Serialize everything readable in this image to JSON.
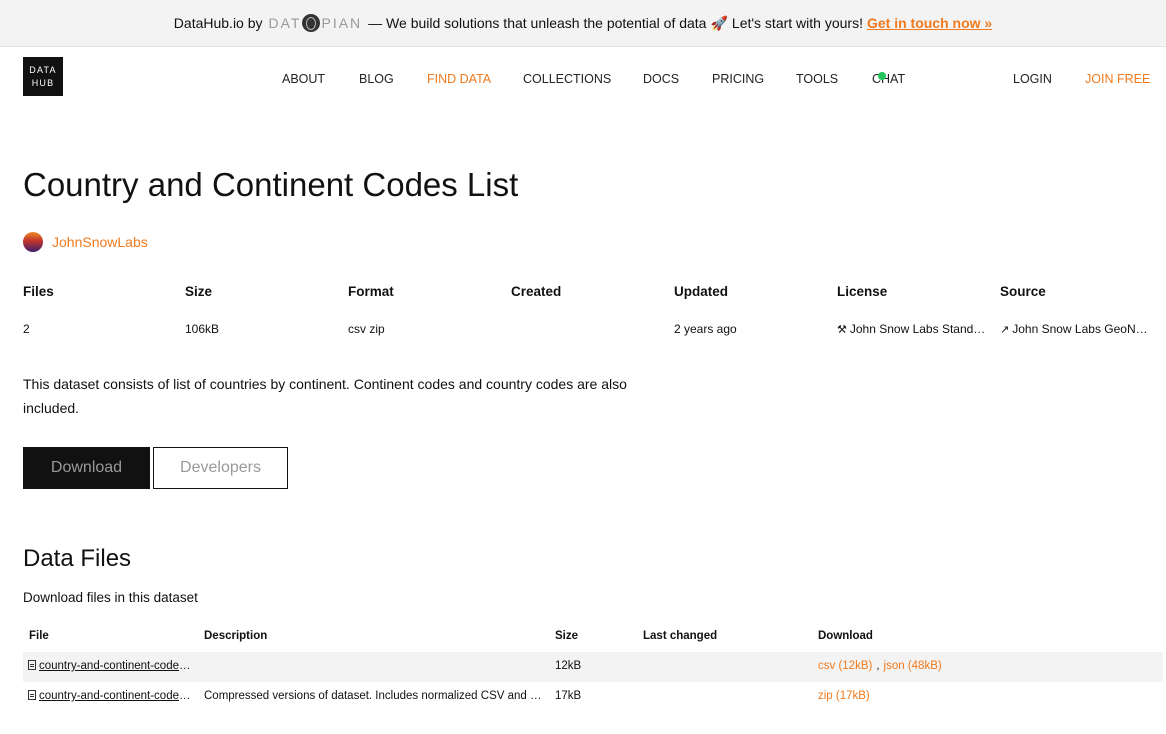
{
  "banner": {
    "prefix": "DataHub.io by",
    "brand": "DAT PIAN",
    "message": "— We build solutions that unleash the potential of data",
    "rocket_icon": "rocket-icon",
    "message2": "Let's start with yours!",
    "cta": "Get in touch now »"
  },
  "logo": {
    "line1": "DATA",
    "line2": "HUB"
  },
  "nav": {
    "items": [
      "ABOUT",
      "BLOG",
      "FIND DATA",
      "COLLECTIONS",
      "DOCS",
      "PRICING",
      "TOOLS",
      "CHAT"
    ],
    "active": "FIND DATA",
    "login": "LOGIN",
    "join": "JOIN FREE"
  },
  "dataset": {
    "title": "Country and Continent Codes List",
    "author": "JohnSnowLabs",
    "meta": {
      "headers": [
        "Files",
        "Size",
        "Format",
        "Created",
        "Updated",
        "License",
        "Source"
      ],
      "files": "2",
      "size": "106kB",
      "format": "csv zip",
      "created": "",
      "updated": "2 years ago",
      "license": "John Snow Labs Standard License",
      "source": "John Snow Labs GeoNames"
    },
    "description": "This dataset consists of list of countries by continent. Continent codes and country codes are also included.",
    "buttons": {
      "download": "Download",
      "developers": "Developers"
    }
  },
  "data_files": {
    "title": "Data Files",
    "subtitle": "Download files in this dataset",
    "headers": [
      "File",
      "Description",
      "Size",
      "Last changed",
      "Download"
    ],
    "rows": [
      {
        "file": "country-and-continent-codes-list-csv",
        "description": "",
        "size": "12kB",
        "last_changed": "",
        "downloads": [
          "csv (12kB)",
          "json (48kB)"
        ]
      },
      {
        "file": "country-and-continent-codes-list_zip",
        "description": "Compressed versions of dataset. Includes normalized CSV and JSON data with original data and datapackage.json.",
        "size": "17kB",
        "last_changed": "",
        "downloads": [
          "zip (17kB)"
        ]
      }
    ]
  },
  "colors": {
    "accent": "#f07a1d",
    "chat_online": "#22c55e",
    "banner_bg": "#f3f3f3"
  }
}
